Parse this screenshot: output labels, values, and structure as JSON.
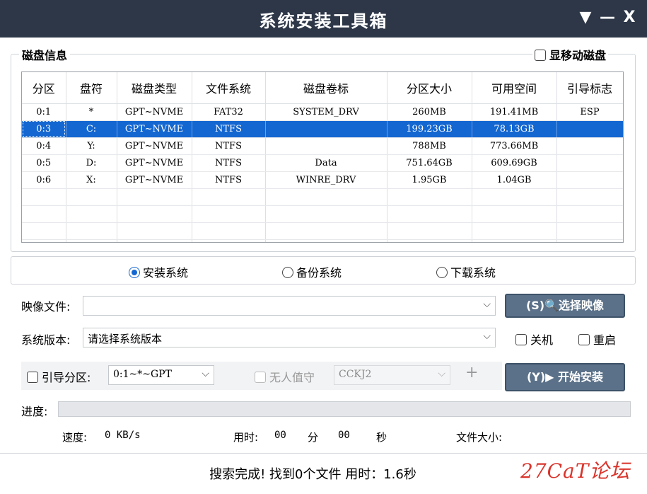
{
  "window": {
    "title": "系统安装工具箱",
    "menu_icon": "▼",
    "minimize_icon": "—",
    "close_icon": "X"
  },
  "disk_info": {
    "title": "磁盘信息",
    "show_removable_label": "显移动磁盘",
    "columns": [
      "分区",
      "盘符",
      "磁盘类型",
      "文件系统",
      "磁盘卷标",
      "分区大小",
      "可用空间",
      "引导标志"
    ],
    "rows": [
      [
        "0:1",
        "*",
        "GPT~NVME",
        "FAT32",
        "SYSTEM_DRV",
        "260MB",
        "191.41MB",
        "ESP"
      ],
      [
        "0:3",
        "C:",
        "GPT~NVME",
        "NTFS",
        "",
        "199.23GB",
        "78.13GB",
        ""
      ],
      [
        "0:4",
        "Y:",
        "GPT~NVME",
        "NTFS",
        "",
        "788MB",
        "773.66MB",
        ""
      ],
      [
        "0:5",
        "D:",
        "GPT~NVME",
        "NTFS",
        "Data",
        "751.64GB",
        "609.69GB",
        ""
      ],
      [
        "0:6",
        "X:",
        "GPT~NVME",
        "NTFS",
        "WINRE_DRV",
        "1.95GB",
        "1.04GB",
        ""
      ]
    ],
    "selected_row": 1
  },
  "mode": {
    "install": "安装系统",
    "backup": "备份系统",
    "download": "下载系统",
    "selected": "install"
  },
  "image": {
    "label": "映像文件:",
    "value": "",
    "button": "(S)🔍选择映像"
  },
  "version": {
    "label": "系统版本:",
    "value": "请选择系统版本",
    "shutdown": "关机",
    "restart": "重启"
  },
  "boot": {
    "label": "引导分区:",
    "value": "0:1~*~GPT",
    "unattended": "无人值守",
    "unattended_value": "CCKJ2",
    "plus": "+",
    "start_button": "(Y)▶ 开始安装"
  },
  "progress": {
    "label": "进度:",
    "percent": 0
  },
  "stats": {
    "speed_label": "速度:",
    "speed_value": "0 KB/s",
    "time_label": "用时:",
    "min_value": "00",
    "min_unit": "分",
    "sec_value": "00",
    "sec_unit": "秒",
    "size_label": "文件大小:"
  },
  "status": "搜索完成!  找到0个文件  用时：1.6秒",
  "watermark": "27CaT论坛",
  "colors": {
    "titlebar": "#2d3748",
    "selection": "#1467d1",
    "button": "#5b7189"
  }
}
